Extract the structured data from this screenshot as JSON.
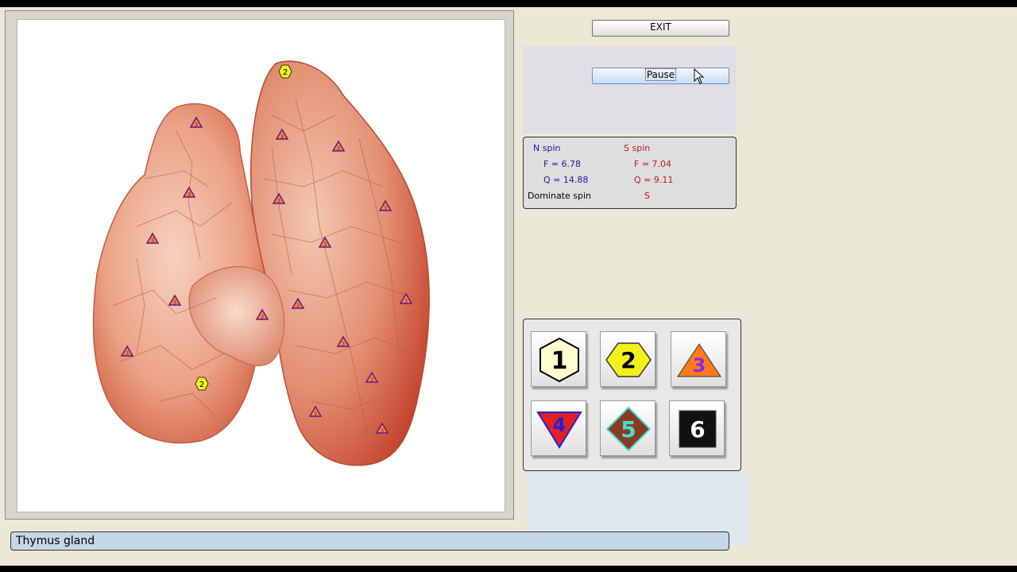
{
  "organ_view": {
    "label": "Thymus gland",
    "image_description": "Anatomical illustration of the thymus gland with diagnostic markers",
    "markers": [
      {
        "level": "2",
        "shape": "hexagon"
      },
      {
        "level": "2",
        "shape": "hexagon"
      },
      {
        "level": "3",
        "shape": "triangle",
        "count": 18
      }
    ]
  },
  "toolbar": {
    "exit_label": "EXIT",
    "pause_label": "Pause"
  },
  "spin": {
    "n_header": "N spin",
    "s_header": "S spin",
    "n_f": "F =  6.78",
    "n_q": "Q = 14.88",
    "s_f": "F =  7.04",
    "s_q": "Q =  9.11",
    "dominate_label": "Dominate spin",
    "dominate_value": "S"
  },
  "palette": [
    {
      "label": "1",
      "shape": "hexagon-outline",
      "fill": "#ffffd0",
      "text_color": "#000000"
    },
    {
      "label": "2",
      "shape": "hexagon",
      "fill": "#f2f21a",
      "text_color": "#000000"
    },
    {
      "label": "3",
      "shape": "triangle",
      "fill": "#ff7a1a",
      "text_color": "#8a2be2"
    },
    {
      "label": "4",
      "shape": "inverted-triangle",
      "fill": "#e52020",
      "text_color": "#2020e0"
    },
    {
      "label": "5",
      "shape": "diamond",
      "fill": "#8b3a22",
      "text_color": "#40e0d0"
    },
    {
      "label": "6",
      "shape": "square",
      "fill": "#111111",
      "text_color": "#ffffff"
    }
  ],
  "colors": {
    "background": "#ebe8d8",
    "status_bar": "#c5d7e8",
    "n_spin": "#1a1aa0",
    "s_spin": "#c01818"
  }
}
